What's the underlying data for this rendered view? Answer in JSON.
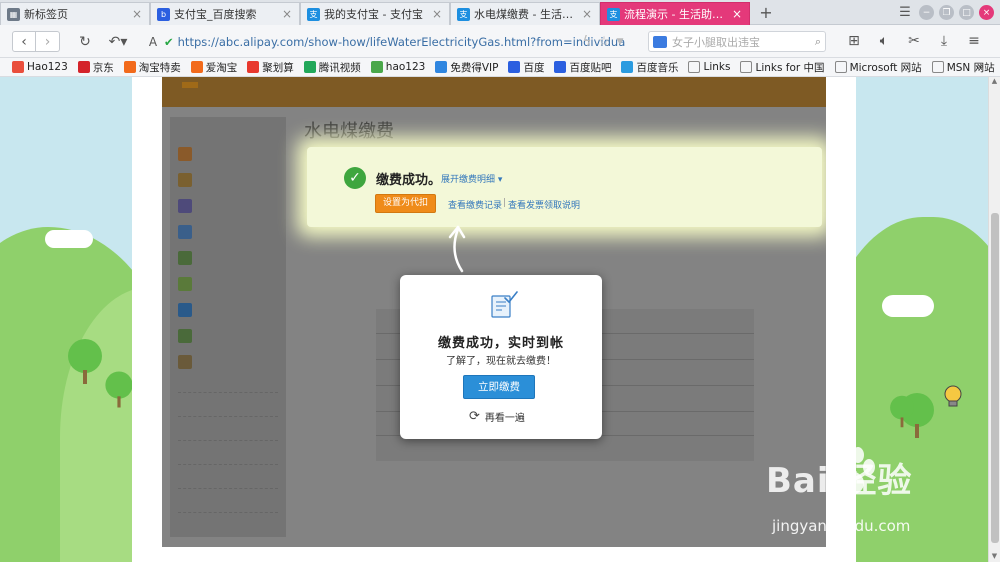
{
  "browser": {
    "tabs": [
      {
        "label": "新标签页",
        "icon": "grid-icon",
        "active": false
      },
      {
        "label": "支付宝_百度搜索",
        "icon": "baidu-icon",
        "active": false
      },
      {
        "label": "我的支付宝 - 支付宝",
        "icon": "alipay-icon",
        "active": false
      },
      {
        "label": "水电煤缴费 - 生活助手",
        "icon": "alipay-icon",
        "active": false
      },
      {
        "label": "流程演示 - 生活助手水电...",
        "icon": "alipay-icon",
        "active": true
      }
    ],
    "address": {
      "url": "https://abc.alipay.com/show-how/lifeWaterElectricityGas.html?from=individua"
    },
    "search": {
      "placeholder": "女子小腿取出违宝"
    },
    "bookmarks": [
      {
        "label": "Hao123",
        "color": "#e94e3c"
      },
      {
        "label": "京东",
        "color": "#d4232a"
      },
      {
        "label": "淘宝特卖",
        "color": "#f26a1b"
      },
      {
        "label": "爱淘宝",
        "color": "#f26a1b"
      },
      {
        "label": "聚划算",
        "color": "#e8382e"
      },
      {
        "label": "腾讯视频",
        "color": "#22a85a"
      },
      {
        "label": "hao123",
        "color": "#4aa74a"
      },
      {
        "label": "免费得VIP",
        "color": "#2f86e0"
      },
      {
        "label": "百度",
        "color": "#2b5fe0"
      },
      {
        "label": "百度贴吧",
        "color": "#2b5fe0"
      },
      {
        "label": "百度音乐",
        "color": "#2b9be0"
      },
      {
        "label": "Links",
        "color": "#999999"
      },
      {
        "label": "Links for 中国",
        "color": "#999999"
      },
      {
        "label": "Microsoft 网站",
        "color": "#999999"
      },
      {
        "label": "MSN 网站",
        "color": "#999999"
      }
    ]
  },
  "demo": {
    "page_title": "水电煤缴费",
    "success": {
      "title": "缴费成功。",
      "detail_link": "展开缴费明细",
      "auto_button": "设置为代扣",
      "record_link": "查看缴费记录",
      "separator": "|",
      "invoice_link": "查看发票领取说明"
    },
    "modal": {
      "title": "缴费成功，实时到帐",
      "subtitle": "了解了，现在就去缴费！",
      "pay_button": "立即缴费",
      "replay_label": "再看一遍"
    }
  },
  "watermark": {
    "brand": "Bai 经验",
    "url": "jingyan.baidu.com"
  },
  "colors": {
    "active_tab": "#e4397a",
    "success_green": "#3ea63e",
    "orange_button": "#ef8b19",
    "blue_button": "#2b8fd8",
    "link_blue": "#3377bb",
    "sky": "#c8e7ef",
    "grass": "#8fd06b"
  }
}
